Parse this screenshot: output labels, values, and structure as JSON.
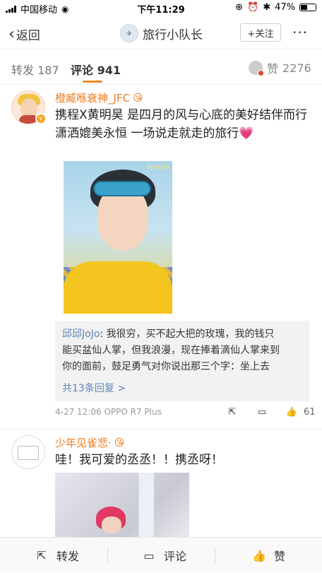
{
  "status_bar": {
    "carrier": "中国移动",
    "time": "下午11:29",
    "battery_text": "47%",
    "battery_level": 0.47
  },
  "nav": {
    "back_label": "返回",
    "title": "旅行小队长",
    "follow_label": "+关注",
    "more": "···"
  },
  "tabs": {
    "repost": {
      "label": "转发",
      "count": "187"
    },
    "comments": {
      "label": "评论",
      "count": "941"
    },
    "likes": {
      "label": "赞",
      "count": "2276"
    }
  },
  "comments": [
    {
      "author": "橙臧喺衰神_JFC",
      "text_line1": "携程X黄明昊 是四月的风与心底的美好结伴而行",
      "text_line2": "潇洒媲美永恒 一场说走就走的旅行💗",
      "reply": {
        "author": "邱邱JoJo",
        "line1": "我很穷，买不起大把的玫瑰，我的钱只",
        "line2": "能买盆仙人掌，但我浪漫，现在捧着滴仙人掌来到",
        "line3": "你的面前，鼓足勇气对你说出那三个字：坐上去",
        "more": "共13条回复 >"
      },
      "meta": "4-27 12:06  OPPO R7 Plus",
      "like_count": "61",
      "watermark": "Sinslin"
    },
    {
      "author": "少年见雀悲·",
      "text": "哇！我可爱的丞丞！！携丞呀！"
    }
  ],
  "bottom_bar": {
    "repost": "转发",
    "comment": "评论",
    "like": "赞"
  },
  "colors": {
    "accent": "#f28b2a",
    "username": "#f07c20",
    "link": "#5f86b8"
  }
}
